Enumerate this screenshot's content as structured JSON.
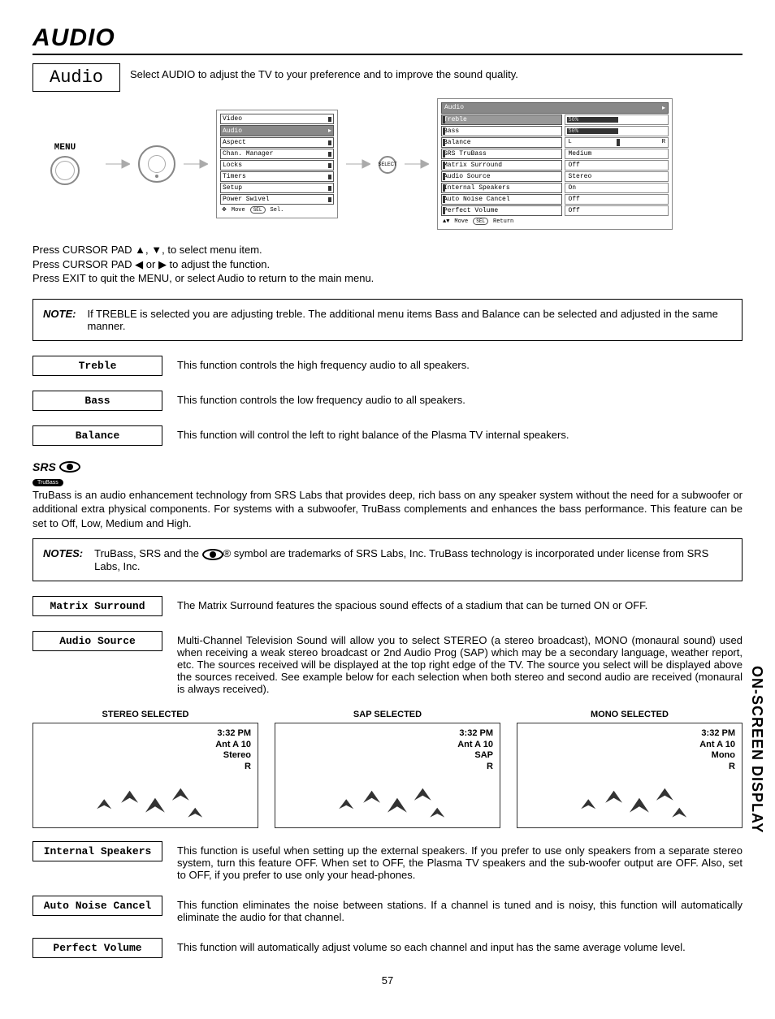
{
  "page_title": "AUDIO",
  "audio_box_label": "Audio",
  "intro": "Select AUDIO to adjust the TV to your preference and to improve the sound quality.",
  "menu_label": "MENU",
  "sel_label": "SELECT",
  "main_menu": {
    "items": [
      "Video",
      "Audio",
      "Aspect",
      "Chan. Manager",
      "Locks",
      "Timers",
      "Setup",
      "Power Swivel"
    ],
    "highlight": "Audio",
    "foot_move": "Move",
    "foot_sel": "Sel.",
    "foot_sel_btn": "SEL"
  },
  "audio_menu": {
    "title": "Audio",
    "rows": [
      {
        "label": "Treble",
        "value": "50%",
        "bar": 50,
        "hl": true
      },
      {
        "label": "Bass",
        "value": "50%",
        "bar": 50
      },
      {
        "label": "Balance",
        "value": "L          R",
        "bar": 0,
        "balance": true
      },
      {
        "label": "SRS TruBass",
        "value": "Medium"
      },
      {
        "label": "Matrix Surround",
        "value": "Off"
      },
      {
        "label": "Audio Source",
        "value": "Stereo"
      },
      {
        "label": "Internal Speakers",
        "value": "On"
      },
      {
        "label": "Auto Noise Cancel",
        "value": "Off"
      },
      {
        "label": "Perfect Volume",
        "value": "Off"
      }
    ],
    "foot_move": "Move",
    "foot_return": "Return",
    "foot_sel_btn": "SEL"
  },
  "instructions": {
    "l1": "Press CURSOR PAD ▲, ▼, to select menu item.",
    "l2": "Press CURSOR PAD  ◀ or ▶ to adjust the function.",
    "l3": "Press EXIT to quit the MENU, or select Audio to return to the main menu."
  },
  "note1": {
    "label": "NOTE:",
    "text": "If TREBLE is selected you are adjusting treble.  The additional menu items Bass and Balance can be selected and adjusted in the same manner."
  },
  "terms": {
    "treble": {
      "label": "Treble",
      "desc": "This function controls the high frequency audio to all speakers."
    },
    "bass": {
      "label": "Bass",
      "desc": "This function controls the low frequency audio to all speakers."
    },
    "balance": {
      "label": "Balance",
      "desc": "This function will control the left to right balance of the Plasma TV internal speakers."
    }
  },
  "srs": {
    "logo_text": "SRS",
    "logo_sub": "TruBass",
    "body": "TruBass is an audio enhancement technology from SRS Labs that provides deep, rich bass on any speaker system without the need for a subwoofer or additional extra physical components.  For systems with a subwoofer, TruBass complements and enhances the bass performance.  This feature can be set to Off, Low, Medium and High."
  },
  "notes2": {
    "label": "NOTES:",
    "text_a": "TruBass, SRS and the ",
    "text_b": "® symbol are trademarks of SRS Labs, Inc.  TruBass technology is incorporated under license from SRS Labs, Inc."
  },
  "matrix": {
    "label": "Matrix Surround",
    "desc": "The Matrix Surround features the spacious sound effects of a stadium that can be turned ON or OFF."
  },
  "audio_source": {
    "label": "Audio Source",
    "desc": "Multi-Channel Television Sound will allow you to select STEREO (a stereo broadcast), MONO (monaural sound) used when receiving a weak stereo broadcast or 2nd Audio Prog (SAP) which may be a secondary language, weather report, etc. The sources received will be displayed at the top right edge of the TV.  The source you select will be displayed above the sources received.  See example below for each selection when both stereo and second audio are received (monaural is always received)."
  },
  "examples": {
    "stereo": {
      "title": "STEREO SELECTED",
      "time": "3:32 PM",
      "ch": "Ant A 10",
      "src": "Stereo",
      "rating": "R"
    },
    "sap": {
      "title": "SAP SELECTED",
      "time": "3:32 PM",
      "ch": "Ant A 10",
      "src": "SAP",
      "rating": "R"
    },
    "mono": {
      "title": "MONO SELECTED",
      "time": "3:32 PM",
      "ch": "Ant A 10",
      "src": "Mono",
      "rating": "R"
    }
  },
  "internal_speakers": {
    "label": "Internal Speakers",
    "desc": "This function is useful when setting up the external speakers.  If you prefer to use only speakers from a separate stereo system, turn this feature OFF.  When set to OFF, the Plasma TV speakers and the sub-woofer output are OFF.  Also, set to OFF, if you prefer to use only your head-phones."
  },
  "auto_noise": {
    "label": "Auto Noise Cancel",
    "desc": "This function eliminates the noise between stations. If a channel is tuned and is noisy, this function will automatically eliminate the audio for that channel."
  },
  "perfect_volume": {
    "label": "Perfect Volume",
    "desc": "This function will automatically adjust volume so each channel  and input has the same average volume level."
  },
  "side_tab": "ON-SCREEN DISPLAY",
  "page_number": "57"
}
